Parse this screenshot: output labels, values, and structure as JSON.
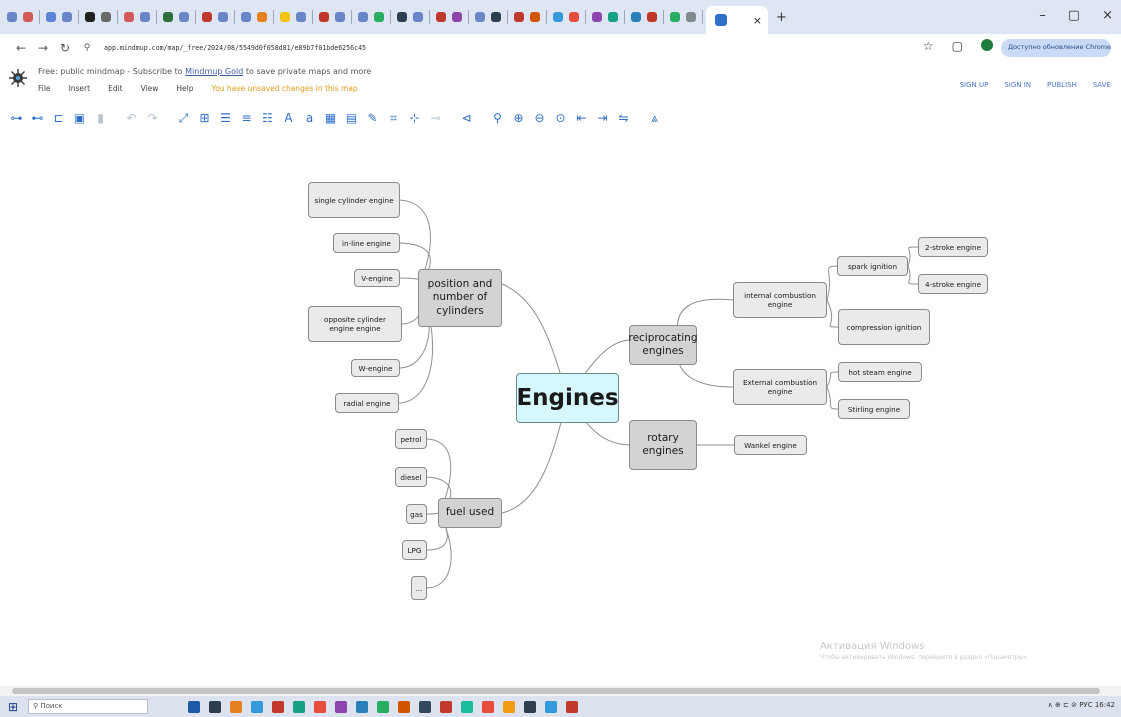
{
  "browser": {
    "tab_favicon_colors": [
      "#6a86c8",
      "#d45a5a",
      "#5b86d6",
      "#6a86c8",
      "#202020",
      "#6a6a6a",
      "#d45a5a",
      "#6a86c8",
      "#2c6e3c",
      "#6a86c8",
      "#c0392b",
      "#6a86c8",
      "#6a86c8",
      "#e67e22",
      "#f1c40f",
      "#6a86c8",
      "#c0392b",
      "#6a86c8",
      "#6a86c8",
      "#27ae60",
      "#2c3e50",
      "#6a86c8",
      "#c0392b",
      "#8e44ad",
      "#6a86c8",
      "#2c3e50",
      "#c0392b",
      "#d35400",
      "#3498db",
      "#e74c3c",
      "#8e44ad",
      "#16a085",
      "#2980b9",
      "#c0392b",
      "#27ae60",
      "#7f8c8d"
    ],
    "active_tab_close": "×",
    "new_tab": "+",
    "window_controls": [
      "–",
      "▢",
      "×"
    ],
    "url": "app.mindmup.com/map/_free/2024/08/5549d0f058d81/e89b7f01bde6256c45",
    "profile_label": "Доступно обновление Chrome",
    "address_icons": [
      "☆",
      "▢"
    ]
  },
  "app": {
    "promo_text": "Free: public mindmap - Subscribe to",
    "promo_link": "Mindmup Gold",
    "promo_suffix": "to save private maps and more",
    "menu": [
      "File",
      "Insert",
      "Edit",
      "View",
      "Help"
    ],
    "unsaved_notice": "You have unsaved changes in this map",
    "right_actions": [
      "SIGN UP",
      "SIGN IN",
      "PUBLISH",
      "SAVE"
    ],
    "toolbar_icons": [
      "add-child",
      "add-sibling",
      "insert-parent",
      "add-icon",
      "delete",
      "undo",
      "redo",
      "connect",
      "link-box",
      "align-left",
      "align-center",
      "align-right",
      "font-size-up",
      "font-size-down",
      "image",
      "note",
      "attach",
      "collapse",
      "expand-all",
      "collapse-all",
      "layout",
      "search",
      "zoom-in",
      "zoom-out",
      "reset-zoom",
      "left",
      "right",
      "balance",
      "priority"
    ],
    "accent": "#2f6fc8"
  },
  "mindmap": {
    "central": "Engines",
    "branches": {
      "position": "position and number of cylinders",
      "fuel": "fuel used",
      "reciprocating": "reciprocating engines",
      "rotary": "rotary engines"
    },
    "position_children": [
      "single cylinder engine",
      "in-line engine",
      "V-engine",
      "opposite cylinder engine engine",
      "W-engine",
      "radial engine"
    ],
    "fuel_children": [
      "petrol",
      "diesel",
      "gas",
      "LPG",
      "..."
    ],
    "reciprocating_children": [
      "internal combustion engine",
      "External combustion engine"
    ],
    "internal_children": [
      "spark ignition",
      "compression ignition"
    ],
    "spark_children": [
      "2-stroke engine",
      "4-stroke engine"
    ],
    "external_children": [
      "hot steam engine",
      "Stirling engine"
    ],
    "rotary_children": [
      "Wankel engine"
    ]
  },
  "watermark": {
    "line1": "Активация Windows",
    "line2": "Чтобы активировать Windows, перейдите в раздел «Параметры»."
  },
  "taskbar": {
    "search_placeholder": "Поиск",
    "app_colors": [
      "#1e5aa8",
      "#2c3e50",
      "#e67e22",
      "#3498db",
      "#c0392b",
      "#16a085",
      "#e74c3c",
      "#8e44ad",
      "#2980b9",
      "#27ae60",
      "#d35400",
      "#34495e",
      "#c0392b",
      "#1abc9c",
      "#e74c3c",
      "#f39c12",
      "#2c3e50",
      "#3498db",
      "#c0392b"
    ],
    "tray_text": "∧ ⊕ ⊏ ⊘ РУС 16:42"
  }
}
